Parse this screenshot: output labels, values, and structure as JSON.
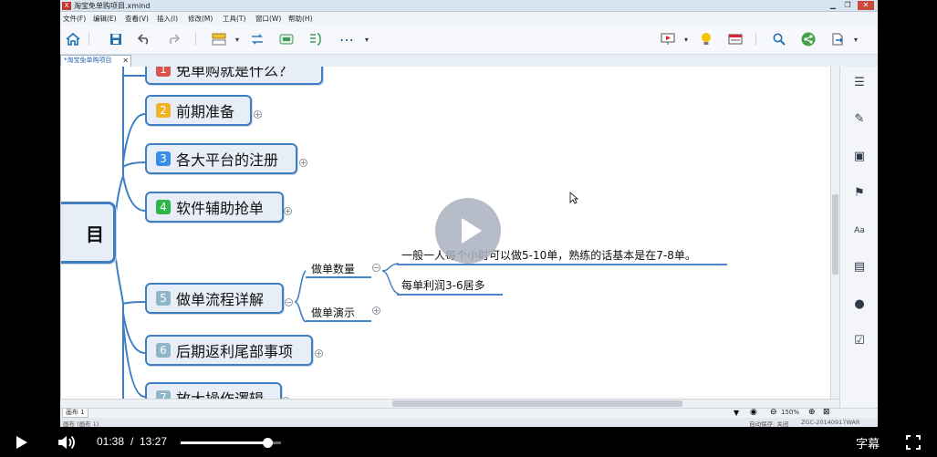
{
  "window": {
    "title": "淘宝免单购项目.xmind",
    "logo": "X"
  },
  "menu": [
    "文件(F)",
    "编辑(E)",
    "查看(V)",
    "插入(I)",
    "修改(M)",
    "工具(T)",
    "窗口(W)",
    "帮助(H)"
  ],
  "tab": {
    "label": "*淘宝免单购项目",
    "close": "✕"
  },
  "map": {
    "root_fragment": "目",
    "topics": [
      {
        "num": "1",
        "label": "免单购就是什么？",
        "badge_color": "#d9534f"
      },
      {
        "num": "2",
        "label": "前期准备",
        "badge_color": "#f0b323"
      },
      {
        "num": "3",
        "label": "各大平台的注册",
        "badge_color": "#3a8ee6"
      },
      {
        "num": "4",
        "label": "软件辅助抢单",
        "badge_color": "#2fb545"
      },
      {
        "num": "5",
        "label": "做单流程详解",
        "badge_color": "#8fb6c8"
      },
      {
        "num": "6",
        "label": "后期返利尾部事项",
        "badge_color": "#8fb6c8"
      },
      {
        "num": "7",
        "label": "放大操作逻辑",
        "badge_color": "#8fb6c8"
      }
    ],
    "subtopics": [
      {
        "label": "做单数量"
      },
      {
        "label": "做单演示"
      }
    ],
    "details": [
      {
        "label": "一般一人每个小时可以做5-10单，熟练的话基本是在7-8单。"
      },
      {
        "label": "每单利润3-6居多"
      }
    ]
  },
  "sheet": {
    "tab": "画布 1",
    "zoom": "150%"
  },
  "status": {
    "left": "画布 (画布 1)",
    "autosave": "自动保存: 关闭",
    "build": "ZGC-20140917WAR"
  },
  "player": {
    "current_time": "01:38",
    "separator": "/",
    "total_time": "13:27",
    "progress": 0.1215,
    "subtitle_label": "字幕"
  },
  "icons": {
    "toolbar": [
      "home-icon",
      "save-icon",
      "undo-icon",
      "redo-icon",
      "structure-icon",
      "relationship-icon",
      "boundary-icon",
      "summary-icon",
      "more-icon"
    ],
    "sidebar": [
      "outline-icon",
      "format-icon",
      "image-icon",
      "marker-icon",
      "notes-icon",
      "attachment-icon",
      "comment-icon",
      "task-icon"
    ]
  }
}
